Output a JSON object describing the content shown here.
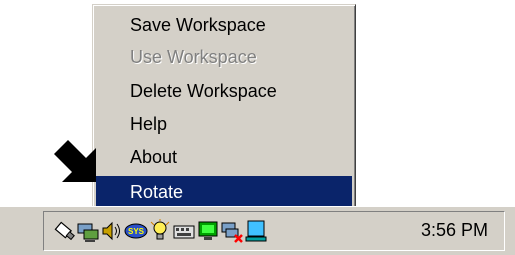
{
  "menu": {
    "items": [
      {
        "label": "Save Workspace",
        "state": "normal"
      },
      {
        "label": "Use Workspace",
        "state": "disabled"
      },
      {
        "label": "Delete Workspace",
        "state": "normal"
      },
      {
        "label": "Help",
        "state": "normal"
      },
      {
        "label": "About",
        "state": "normal"
      },
      {
        "label": "Rotate",
        "state": "selected"
      }
    ]
  },
  "taskbar": {
    "clock": "3:56 PM",
    "tray_icons": [
      "usb-drive-icon",
      "network-icon",
      "volume-icon",
      "sys-icon",
      "lightbulb-icon",
      "keyboard-icon",
      "monitor-icon",
      "network-disconnected-icon",
      "display-icon"
    ]
  },
  "colors": {
    "menu_bg": "#d4d0c8",
    "highlight": "#0a246a",
    "highlight_text": "#ffffff",
    "disabled_text": "#808080"
  }
}
